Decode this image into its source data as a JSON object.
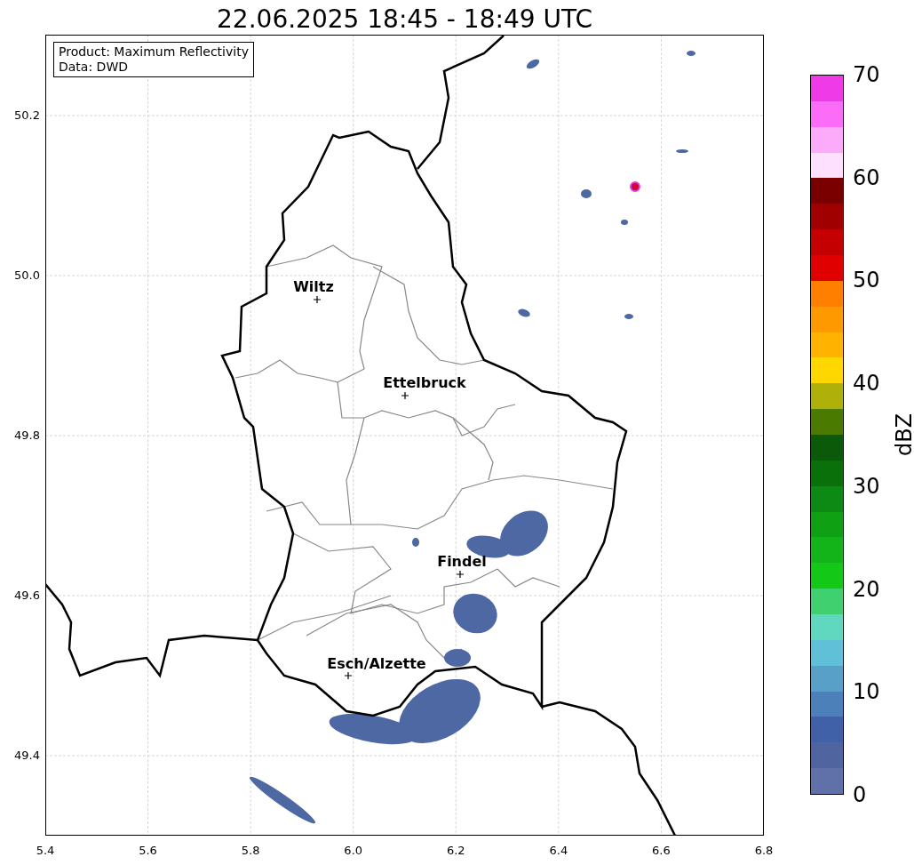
{
  "title": "22.06.2025 18:45 - 18:49 UTC",
  "info_box": {
    "lines": [
      "Product: Maximum Reflectivity",
      "Data: DWD"
    ]
  },
  "map": {
    "cities": [
      {
        "name": "Wiltz"
      },
      {
        "name": "Ettelbruck"
      },
      {
        "name": "Findel"
      },
      {
        "name": "Esch/Alzette"
      }
    ]
  },
  "x_ticks": [
    "5.4",
    "5.6",
    "5.8",
    "6.0",
    "6.2",
    "6.4",
    "6.6",
    "6.8"
  ],
  "y_ticks": [
    "50.2",
    "50.0",
    "49.8",
    "49.6",
    "49.4"
  ],
  "colorbar": {
    "label": "dBZ",
    "ticks": [
      "70",
      "60",
      "50",
      "40",
      "30",
      "20",
      "10",
      "0"
    ],
    "bands": [
      {
        "color": "#ef3ae8"
      },
      {
        "color": "#fb6cf8"
      },
      {
        "color": "#fcaafa"
      },
      {
        "color": "#fde0fd"
      },
      {
        "color": "#7a0000"
      },
      {
        "color": "#a00000"
      },
      {
        "color": "#c40000"
      },
      {
        "color": "#e00000"
      },
      {
        "color": "#ff7f00"
      },
      {
        "color": "#ff9900"
      },
      {
        "color": "#ffb300"
      },
      {
        "color": "#ffd700"
      },
      {
        "color": "#b0b00a"
      },
      {
        "color": "#4a7a00"
      },
      {
        "color": "#0a5a0a"
      },
      {
        "color": "#0a700a"
      },
      {
        "color": "#0c8a14"
      },
      {
        "color": "#10a014"
      },
      {
        "color": "#12b41a"
      },
      {
        "color": "#14c818"
      },
      {
        "color": "#40d070"
      },
      {
        "color": "#60d8c0"
      },
      {
        "color": "#60c0d8"
      },
      {
        "color": "#58a0c8"
      },
      {
        "color": "#4c80b8"
      },
      {
        "color": "#4060a8"
      },
      {
        "color": "#5064a0"
      },
      {
        "color": "#6070a8"
      }
    ]
  }
}
